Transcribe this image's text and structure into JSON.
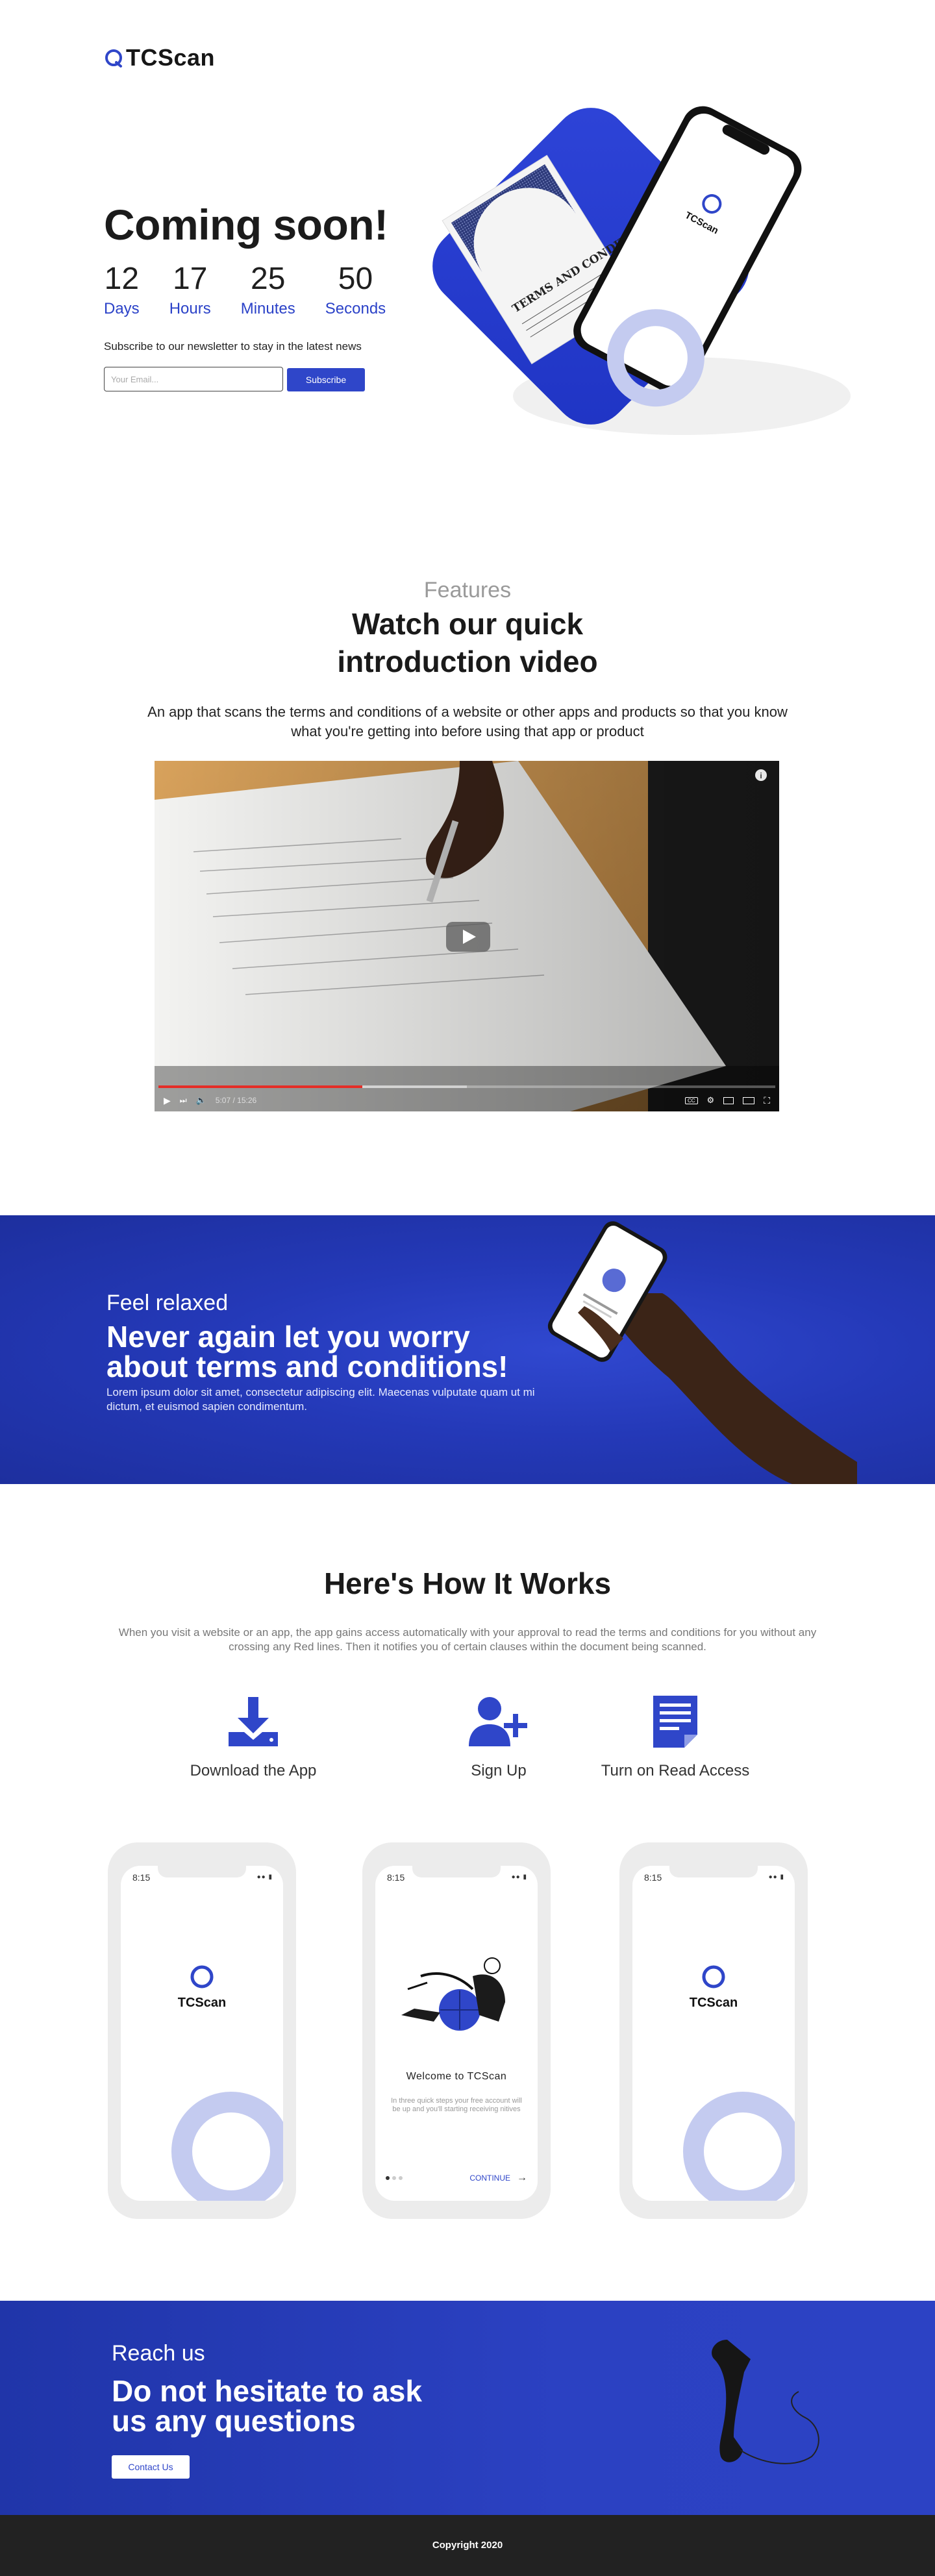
{
  "brand": {
    "name": "TCScan"
  },
  "hero": {
    "title": "Coming soon!",
    "countdown": [
      {
        "value": "12",
        "label": "Days"
      },
      {
        "value": "17",
        "label": "Hours"
      },
      {
        "value": "25",
        "label": "Minutes"
      },
      {
        "value": "50",
        "label": "Seconds"
      }
    ],
    "newsletter_label": "Subscribe to our newsletter to stay in the latest news",
    "email_placeholder": "Your Email...",
    "subscribe_label": "Subscribe",
    "illustration": {
      "document_text": "TERMS AND CONDITIONS",
      "phone_brand": "TCScan"
    }
  },
  "features": {
    "kicker": "Features",
    "title_line1": "Watch our quick",
    "title_line2": "introduction video",
    "description": "An app that scans the terms and conditions of a website or other apps and products so that you know what you're getting into before using that app or product",
    "video": {
      "time": "5:07 / 15:26",
      "progress": 0.33,
      "buffered": 0.5
    }
  },
  "relax": {
    "kicker": "Feel relaxed",
    "title_line1": "Never again let you worry",
    "title_line2": "about terms and conditions!",
    "description": "Lorem ipsum dolor sit amet, consectetur adipiscing elit. Maecenas vulputate quam ut mi dictum, et euismod sapien condimentum."
  },
  "how": {
    "title": "Here's How It Works",
    "description": "When you visit a website or an app, the app gains access automatically with your approval to read the terms and conditions for you without any crossing any Red lines. Then it notifies you of certain clauses within the document being scanned.",
    "steps": [
      {
        "label": "Download the App",
        "icon": "download-icon"
      },
      {
        "label": "Sign Up",
        "icon": "add-user-icon"
      },
      {
        "label": "Turn on Read Access",
        "icon": "document-icon"
      }
    ],
    "phones": [
      {
        "time": "8:15",
        "brand": "TCScan"
      },
      {
        "time": "8:15",
        "welcome": "Welcome to TCScan",
        "subtext": "In three quick steps your free account will be up and you'll starting receiving nitives",
        "cta": "CONTINUE"
      },
      {
        "time": "8:15",
        "brand": "TCScan"
      }
    ]
  },
  "reach": {
    "kicker": "Reach us",
    "title_line1": "Do not hesitate to ask",
    "title_line2": "us any questions",
    "button": "Contact Us"
  },
  "footer": {
    "copyright": "Copyright 2020"
  },
  "colors": {
    "accent": "#2f46c9",
    "dark": "#222222",
    "light_ring": "#c4cbf0"
  }
}
